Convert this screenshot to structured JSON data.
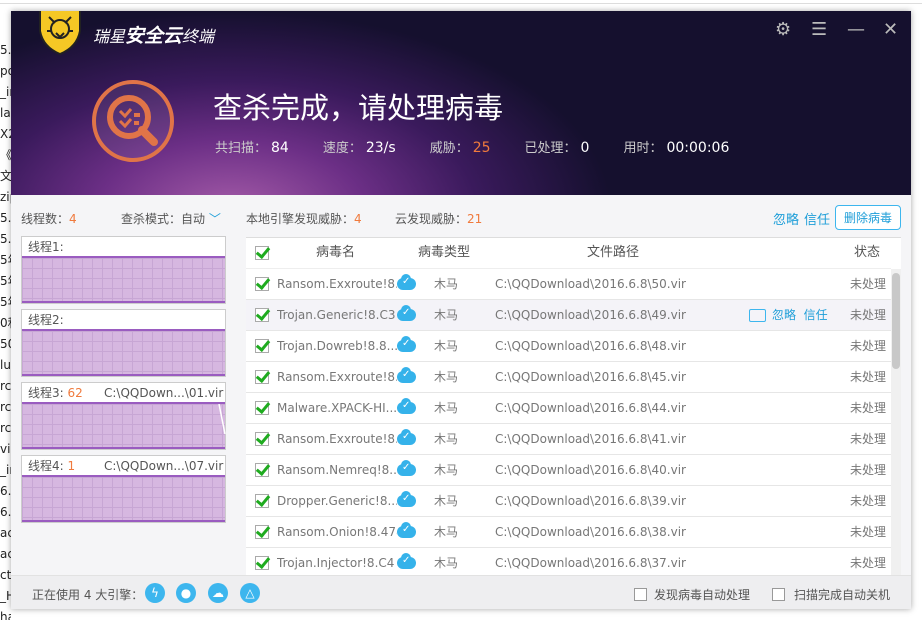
{
  "background_fragments": [
    "5.6",
    "po",
    "_ir",
    "la",
    "X2",
    "《",
    "文",
    "zip",
    "5.6",
    "5.6",
    "5年",
    "5年",
    "5年",
    "0和",
    "50",
    "lu",
    "rc",
    "rc",
    "rc",
    "vir",
    "_ir",
    "6.",
    "6.",
    "ac",
    "ac",
    "ctc",
    "_H",
    "han?"
  ],
  "app": {
    "brand_prefix": "瑞星",
    "brand_main": "安全云",
    "brand_suffix": "终端"
  },
  "window_controls": {
    "settings": "⚙",
    "menu": "☰",
    "minimize": "—",
    "close": "✕"
  },
  "header": {
    "title": "查杀完成，请处理病毒",
    "stats": [
      {
        "label": "共扫描：",
        "value": "84"
      },
      {
        "label": "速度：",
        "value": "23/s"
      },
      {
        "label": "威胁：",
        "value": "25"
      },
      {
        "label": "已处理：",
        "value": "0"
      },
      {
        "label": "用时：",
        "value": "00:00:06"
      }
    ]
  },
  "left": {
    "threads_label": "线程数：",
    "threads_value": "4",
    "mode_label": "查杀模式：",
    "mode_value": "自动",
    "threads": [
      {
        "label": "线程1:",
        "count": "",
        "path": ""
      },
      {
        "label": "线程2:",
        "count": "",
        "path": ""
      },
      {
        "label": "线程3:",
        "count": "62",
        "path": "C:\\QQDown...\\01.vir"
      },
      {
        "label": "线程4:",
        "count": "1",
        "path": "C:\\QQDown...\\07.vir"
      }
    ]
  },
  "summary": {
    "local_label": "本地引擎发现威胁：",
    "local_value": "4",
    "cloud_label": "云发现威胁：",
    "cloud_value": "21",
    "ignore": "忽略",
    "trust": "信任",
    "delete": "删除病毒"
  },
  "table": {
    "headers": {
      "name": "病毒名",
      "type": "病毒类型",
      "path": "文件路径",
      "status": "状态"
    },
    "row_actions": {
      "ignore": "忽略",
      "trust": "信任"
    },
    "rows": [
      {
        "name": "Ransom.Exxroute!8...",
        "type": "木马",
        "path": "C:\\QQDownload\\2016.6.8\\50.vir",
        "status": "未处理"
      },
      {
        "name": "Trojan.Generic!8.C3",
        "type": "木马",
        "path": "C:\\QQDownload\\2016.6.8\\49.vir",
        "status": "未处理"
      },
      {
        "name": "Trojan.Dowreb!8.8...",
        "type": "木马",
        "path": "C:\\QQDownload\\2016.6.8\\48.vir",
        "status": "未处理"
      },
      {
        "name": "Ransom.Exxroute!8...",
        "type": "木马",
        "path": "C:\\QQDownload\\2016.6.8\\45.vir",
        "status": "未处理"
      },
      {
        "name": "Malware.XPACK-HI...",
        "type": "木马",
        "path": "C:\\QQDownload\\2016.6.8\\44.vir",
        "status": "未处理"
      },
      {
        "name": "Ransom.Exxroute!8...",
        "type": "木马",
        "path": "C:\\QQDownload\\2016.6.8\\41.vir",
        "status": "未处理"
      },
      {
        "name": "Ransom.Nemreq!8...",
        "type": "木马",
        "path": "C:\\QQDownload\\2016.6.8\\40.vir",
        "status": "未处理"
      },
      {
        "name": "Dropper.Generic!8....",
        "type": "木马",
        "path": "C:\\QQDownload\\2016.6.8\\39.vir",
        "status": "未处理"
      },
      {
        "name": "Ransom.Onion!8.478",
        "type": "木马",
        "path": "C:\\QQDownload\\2016.6.8\\38.vir",
        "status": "未处理"
      },
      {
        "name": "Trojan.Injector!8.C4",
        "type": "木马",
        "path": "C:\\QQDownload\\2016.6.8\\37.vir",
        "status": "未处理"
      }
    ]
  },
  "footer": {
    "engines_label": "正在使用 4 大引擎：",
    "auto_process": "发现病毒自动处理",
    "auto_shutdown": "扫描完成自动关机"
  }
}
